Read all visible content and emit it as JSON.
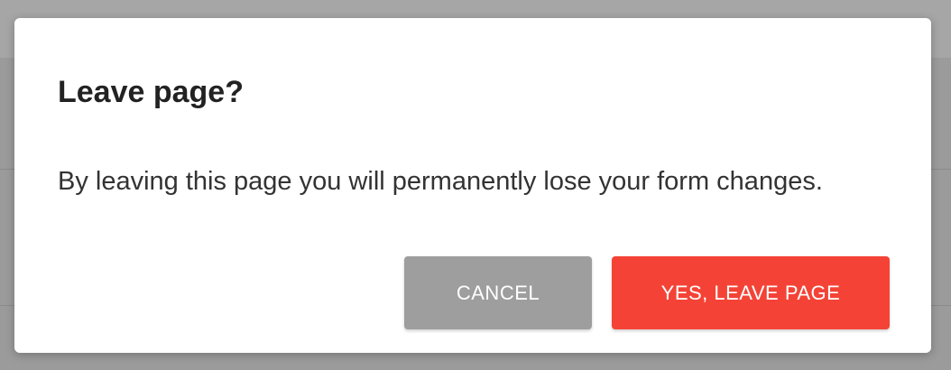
{
  "dialog": {
    "title": "Leave page?",
    "message": "By leaving this page you will permanently lose your form changes.",
    "cancel_label": "CANCEL",
    "confirm_label": "YES, LEAVE PAGE"
  },
  "colors": {
    "overlay": "#9b9b9b",
    "dialog_background": "#ffffff",
    "cancel_button": "#9e9e9e",
    "confirm_button": "#f44336",
    "button_text": "#ffffff",
    "title_text": "#222222"
  }
}
